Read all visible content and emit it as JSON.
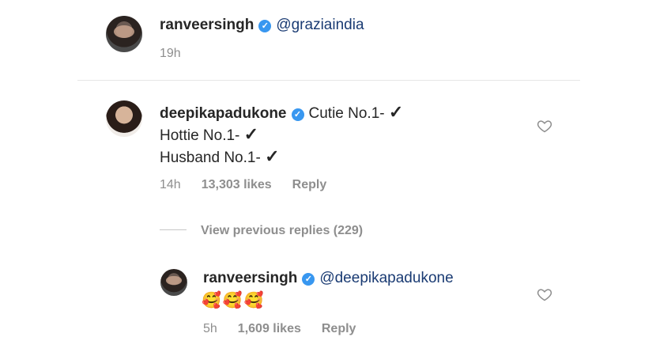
{
  "comment1": {
    "username": "ranveersingh",
    "text": "@graziaindia",
    "time": "19h"
  },
  "comment2": {
    "username": "deepikapadukone",
    "line1": "Cutie No.1-",
    "line2": "Hottie No.1-",
    "line3": "Husband No.1-",
    "time": "14h",
    "likes": "13,303 likes",
    "reply": "Reply"
  },
  "view_previous": "View previous replies (229)",
  "reply1": {
    "username": "ranveersingh",
    "mention": "@deepikapadukone",
    "emojis": "🥰🥰🥰",
    "time": "5h",
    "likes": "1,609 likes",
    "reply": "Reply"
  },
  "colors": {
    "verified": "#3897f0",
    "mention": "#1a3b73",
    "meta": "#8e8e8e"
  },
  "icons": [
    "verified-badge-icon",
    "heart-icon",
    "check-mark-icon"
  ]
}
